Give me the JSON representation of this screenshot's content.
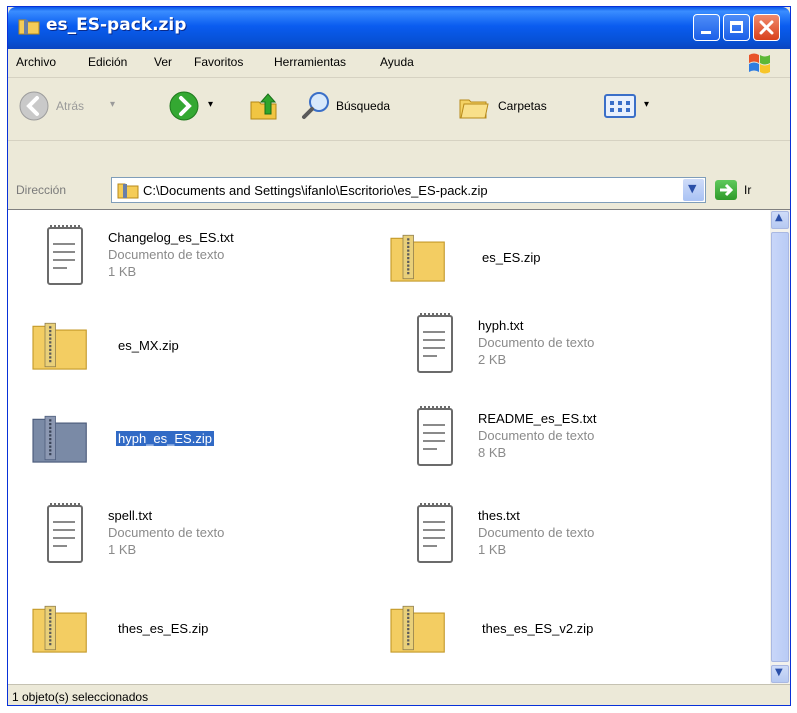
{
  "window": {
    "title": "es_ES-pack.zip"
  },
  "menu": [
    "Archivo",
    "Edición",
    "Ver",
    "Favoritos",
    "Herramientas",
    "Ayuda"
  ],
  "toolbar": {
    "back_label": "Atrás",
    "search_label": "Búsqueda",
    "folders_label": "Carpetas"
  },
  "address": {
    "label": "Dirección",
    "path": "C:\\Documents and Settings\\ifanlo\\Escritorio\\es_ES-pack.zip",
    "go_label": "Ir"
  },
  "files": [
    {
      "name": "Changelog_es_ES.txt",
      "type": "Documento de texto",
      "size": "1 KB",
      "kind": "text"
    },
    {
      "name": "es_ES.zip",
      "kind": "zip"
    },
    {
      "name": "es_MX.zip",
      "kind": "zip"
    },
    {
      "name": "hyph.txt",
      "type": "Documento de texto",
      "size": "2 KB",
      "kind": "text"
    },
    {
      "name": "hyph_es_ES.zip",
      "kind": "zip",
      "selected": true
    },
    {
      "name": "README_es_ES.txt",
      "type": "Documento de texto",
      "size": "8 KB",
      "kind": "text"
    },
    {
      "name": "spell.txt",
      "type": "Documento de texto",
      "size": "1 KB",
      "kind": "text"
    },
    {
      "name": "thes.txt",
      "type": "Documento de texto",
      "size": "1 KB",
      "kind": "text"
    },
    {
      "name": "thes_es_ES.zip",
      "kind": "zip"
    },
    {
      "name": "thes_es_ES_v2.zip",
      "kind": "zip"
    }
  ],
  "status": {
    "text": "1 objeto(s) seleccionados"
  },
  "colors": {
    "titlebar": "#0a5cf0",
    "selection": "#316ac5",
    "chrome": "#ece9d8"
  }
}
